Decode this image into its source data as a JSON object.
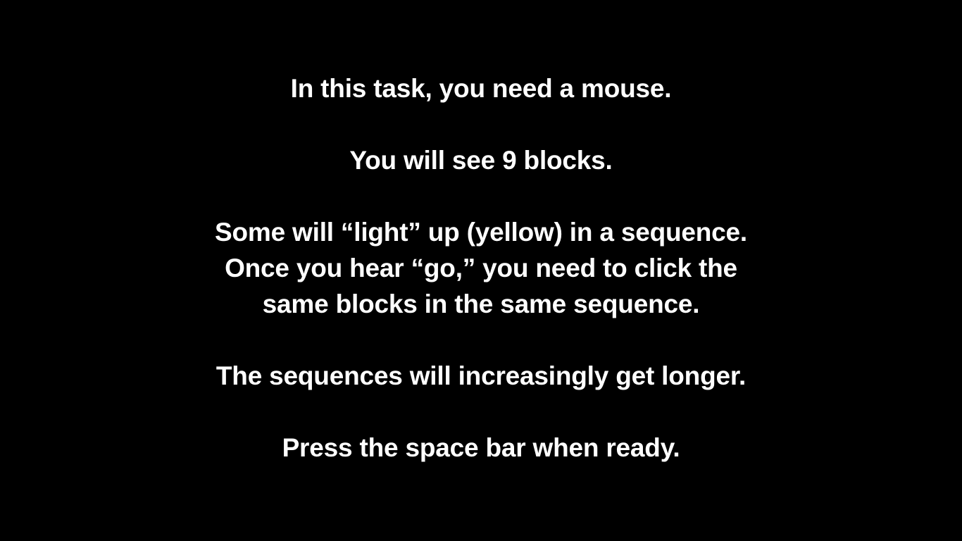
{
  "instructions": {
    "mouse_line": "In this task, you need a mouse.",
    "blocks_line": "You will see 9 blocks.",
    "sequence_para": [
      "Some will “light” up (yellow) in a sequence.",
      "Once you hear “go,” you need to click the",
      "same blocks in the same sequence."
    ],
    "longer_line": "The sequences will increasingly get longer.",
    "ready_line": "Press the space bar when ready."
  }
}
